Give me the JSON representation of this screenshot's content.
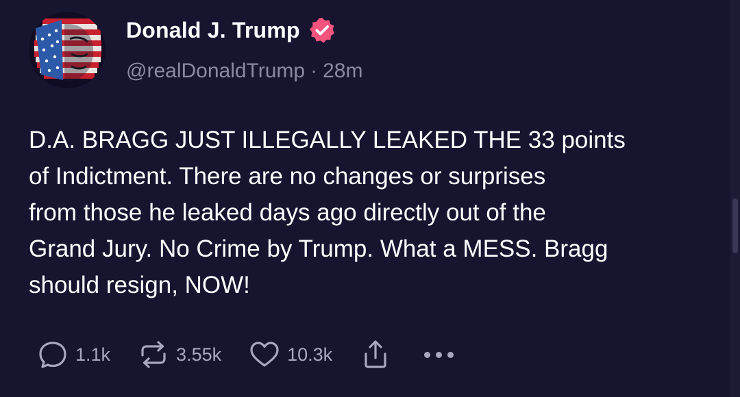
{
  "author": {
    "display_name": "Donald J. Trump",
    "handle": "@realDonaldTrump",
    "separator": "·",
    "time_ago": "28m",
    "verified": true,
    "badge_color": "#f2547d"
  },
  "post": {
    "text": "D.A. BRAGG JUST ILLEGALLY LEAKED THE 33 points\nof Indictment. There are no changes or surprises\nfrom those he leaked days ago directly out of the\nGrand Jury. No Crime by Trump. What a MESS. Bragg\nshould resign, NOW!"
  },
  "actions": {
    "replies": "1.1k",
    "reposts": "3.55k",
    "likes": "10.3k",
    "reply_icon": "reply-icon",
    "repost_icon": "repost-icon",
    "like_icon": "heart-icon",
    "share_icon": "share-icon",
    "more_icon": "more-icon"
  },
  "colors": {
    "background": "#171430",
    "text": "#ffffff",
    "muted": "#8b88a3",
    "icon": "#a9a6bf"
  }
}
